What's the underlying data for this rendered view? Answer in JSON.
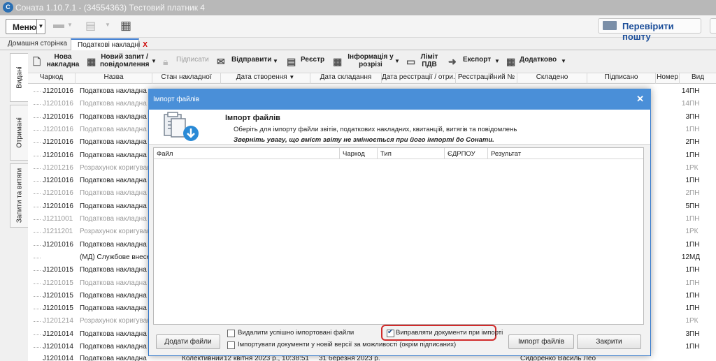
{
  "window": {
    "title": "Соната 1.10.7.1 - (34554363) Тестовий платник 4"
  },
  "toolbar": {
    "menu_label": "Меню",
    "check_mail_label": "Перевірити пошту"
  },
  "tabs": [
    {
      "label": "Домашня сторінка"
    },
    {
      "label": "Податкові накладні",
      "close": "X"
    }
  ],
  "side_tabs": [
    "Видані",
    "Отримані",
    "Запити та витяги"
  ],
  "actions": {
    "new_invoice": [
      "Нова",
      "накладна"
    ],
    "new_request": [
      "Новий запит /",
      "повідомлення"
    ],
    "sign": "Підписати",
    "send": "Відправити",
    "registry": "Реєстр",
    "info": [
      "Інформація у",
      "розрізі"
    ],
    "vat_limit": [
      "Ліміт",
      "ПДВ"
    ],
    "export": "Експорт",
    "additional": "Додатково"
  },
  "grid": {
    "columns": [
      "Чаркод",
      "Назва",
      "Стан накладної",
      "Дата створення",
      "Дата складання",
      "Дата реєстрації / отри...",
      "Реєстраційний №",
      "Складено",
      "Підписано",
      "Номер",
      "Вид"
    ],
    "rows": [
      {
        "code": "J1201016",
        "name": "Податкова накладна",
        "num": "14",
        "kind": "ПН"
      },
      {
        "code": "J1201016",
        "name": "Податкова накладна",
        "num": "14",
        "kind": "ПН"
      },
      {
        "code": "J1201016",
        "name": "Податкова накладна",
        "num": "3",
        "kind": "ПН"
      },
      {
        "code": "J1201016",
        "name": "Податкова накладна",
        "num": "1",
        "kind": "ПН"
      },
      {
        "code": "J1201016",
        "name": "Податкова накладна",
        "num": "2",
        "kind": "ПН"
      },
      {
        "code": "J1201016",
        "name": "Податкова накладна",
        "num": "1",
        "kind": "ПН"
      },
      {
        "code": "J1201216",
        "name": "Розрахунок коригування",
        "num": "1",
        "kind": "РК"
      },
      {
        "code": "J1201016",
        "name": "Податкова накладна",
        "num": "1",
        "kind": "ПН"
      },
      {
        "code": "J1201016",
        "name": "Податкова накладна",
        "num": "2",
        "kind": "ПН"
      },
      {
        "code": "J1201016",
        "name": "Податкова накладна",
        "num": "5",
        "kind": "ПН"
      },
      {
        "code": "J1211001",
        "name": "Податкова накладна (е...",
        "num": "1",
        "kind": "ПН"
      },
      {
        "code": "J1211201",
        "name": "Розрахунок коригування",
        "num": "1",
        "kind": "РК"
      },
      {
        "code": "J1201016",
        "name": "Податкова накладна",
        "num": "1",
        "kind": "ПН"
      },
      {
        "code": "",
        "name": "(МД) Службове внесення",
        "num": "12",
        "kind": "МД"
      },
      {
        "code": "J1201015",
        "name": "Податкова накладна",
        "num": "1",
        "kind": "ПН"
      },
      {
        "code": "J1201015",
        "name": "Податкова накладна",
        "num": "1",
        "kind": "ПН"
      },
      {
        "code": "J1201015",
        "name": "Податкова накладна",
        "num": "1",
        "kind": "ПН"
      },
      {
        "code": "J1201015",
        "name": "Податкова накладна",
        "num": "1",
        "kind": "ПН"
      },
      {
        "code": "J1201214",
        "name": "Розрахунок коригування",
        "num": "1",
        "kind": "РК"
      },
      {
        "code": "J1201014",
        "name": "Податкова накладна",
        "num": "3",
        "kind": "ПН"
      },
      {
        "code": "J1201014",
        "name": "Податкова накладна",
        "num": "1",
        "kind": "ПН"
      }
    ],
    "bottom_row": {
      "code": "J1201014",
      "name": "Податкова накладна",
      "state": "Колективний",
      "created": "12 квітня 2023 р., 10:38:51",
      "composed": "31 березня 2023 р.",
      "author": "Сидоренко Василь Лео"
    }
  },
  "dialog": {
    "title": "Імпорт файлів",
    "heading": "Імпорт файлів",
    "subtitle": "Оберіть для імпорту файли звітів, податкових накладних, квитанцій, витягів та повідомлень",
    "warning": "Зверніть увагу, що вміст звіту не змінюється при його імпорті до Сонати.",
    "columns": [
      "Файл",
      "Чаркод",
      "Тип",
      "ЄДРПОУ",
      "Результат"
    ],
    "add_files": "Додати файли",
    "opt_delete": "Видалити успішно імпортовані файли",
    "opt_new_version": "Імпортувати документи у новій версії за можливості (окрім підписаних)",
    "opt_fix": "Виправляти документи при імпорті",
    "import_button": "Імпорт файлів",
    "close_button": "Закрити"
  },
  "colors": {
    "accent": "#2b73c9",
    "highlight": "#d12b2b",
    "brand_text": "#1d4f9a"
  }
}
